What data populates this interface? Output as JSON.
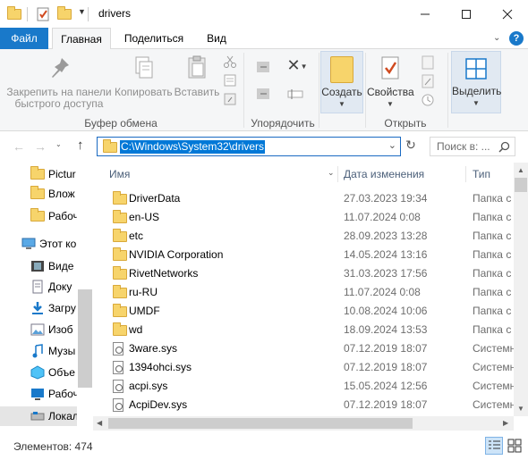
{
  "window": {
    "title": "drivers"
  },
  "ribbon_tabs": {
    "file": "Файл",
    "home": "Главная",
    "share": "Поделиться",
    "view": "Вид"
  },
  "ribbon": {
    "pin_label": "Закрепить на панели быстрого доступа",
    "pin_line1": "Закрепить на панели",
    "pin_line2": "быстрого доступа",
    "copy": "Копировать",
    "paste": "Вставить",
    "group_clipboard": "Буфер обмена",
    "group_organize": "Упорядочить",
    "new": "Создать",
    "properties": "Свойства",
    "group_open": "Открыть",
    "select": "Выделить"
  },
  "address": {
    "path": "C:\\Windows\\System32\\drivers",
    "search_placeholder": "Поиск в: ..."
  },
  "nav": {
    "items": [
      {
        "label": "Pictur",
        "icon": "folder-icon"
      },
      {
        "label": "Влож",
        "icon": "folder-icon"
      },
      {
        "label": "Рабоч",
        "icon": "folder-icon"
      },
      {
        "label": "Этот ко",
        "icon": "computer-icon"
      },
      {
        "label": "Виде",
        "icon": "video-icon"
      },
      {
        "label": "Доку",
        "icon": "documents-icon"
      },
      {
        "label": "Загру",
        "icon": "downloads-icon"
      },
      {
        "label": "Изоб",
        "icon": "pictures-icon"
      },
      {
        "label": "Музы",
        "icon": "music-icon"
      },
      {
        "label": "Объе",
        "icon": "3d-objects-icon"
      },
      {
        "label": "Рабоч",
        "icon": "desktop-icon"
      },
      {
        "label": "Локал",
        "icon": "local-disk-icon"
      }
    ]
  },
  "columns": {
    "name": "Имя",
    "date": "Дата изменения",
    "type": "Тип"
  },
  "files": [
    {
      "name": "DriverData",
      "date": "27.03.2023 19:34",
      "type": "Папка с",
      "kind": "folder"
    },
    {
      "name": "en-US",
      "date": "11.07.2024 0:08",
      "type": "Папка с",
      "kind": "folder"
    },
    {
      "name": "etc",
      "date": "28.09.2023 13:28",
      "type": "Папка с",
      "kind": "folder"
    },
    {
      "name": "NVIDIA Corporation",
      "date": "14.05.2024 13:16",
      "type": "Папка с",
      "kind": "folder"
    },
    {
      "name": "RivetNetworks",
      "date": "31.03.2023 17:56",
      "type": "Папка с",
      "kind": "folder"
    },
    {
      "name": "ru-RU",
      "date": "11.07.2024 0:08",
      "type": "Папка с",
      "kind": "folder"
    },
    {
      "name": "UMDF",
      "date": "10.08.2024 10:06",
      "type": "Папка с",
      "kind": "folder"
    },
    {
      "name": "wd",
      "date": "18.09.2024 13:53",
      "type": "Папка с",
      "kind": "folder"
    },
    {
      "name": "3ware.sys",
      "date": "07.12.2019 18:07",
      "type": "Системн",
      "kind": "sys"
    },
    {
      "name": "1394ohci.sys",
      "date": "07.12.2019 18:07",
      "type": "Системн",
      "kind": "sys"
    },
    {
      "name": "acpi.sys",
      "date": "15.05.2024 12:56",
      "type": "Системн",
      "kind": "sys"
    },
    {
      "name": "AcpiDev.sys",
      "date": "07.12.2019 18:07",
      "type": "Системн",
      "kind": "sys"
    }
  ],
  "status": {
    "items_count": "Элементов: 474"
  },
  "colors": {
    "accent": "#1979ca",
    "selection": "#0078d7",
    "folder": "#f7d46b"
  }
}
